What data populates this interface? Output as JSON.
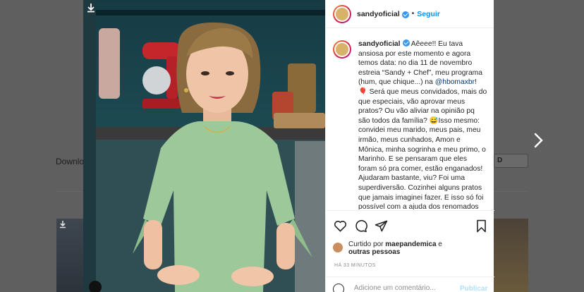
{
  "background": {
    "download_label": "Downlo",
    "pill_label": "D"
  },
  "post": {
    "header": {
      "username": "sandyoficial",
      "separator": "•",
      "follow_label": "Seguir"
    },
    "caption": {
      "username": "sandyoficial",
      "text_1": " Aêeee!! Eu tava ansiosa por este momento e agora temos data: no dia 11 de novembro estreia “Sandy + Chef”, meu programa (hum, que chique...) na ",
      "mention": "@hbomaxbr",
      "text_2": "! 🎈 Será que meus convidados, mais do que especiais, vão aprovar meus pratos? Ou vão aliviar na opinião pq são todos da família? 😅Isso mesmo: convidei meu marido, meus pais, meu irmão, meus cunhados, Amon e Mônica, minha sogrinha e meu primo, o Marinho. E se pensaram que eles foram só pra comer, estão enganados! Ajudaram bastante, viu? Foi uma superdiversão. Cozinhei alguns pratos que jamais imaginei fazer. E isso só foi possível com a ajuda dos renomados chefs Paola Carosella, Murakami, Lili"
    },
    "likes": {
      "prefix": "Curtido por ",
      "user": "maepandemica",
      "conjunction": " e",
      "others": "outras pessoas"
    },
    "timestamp": "HÁ 33 MINUTOS",
    "comment": {
      "placeholder": "Adicione um comentário...",
      "publish_label": "Publicar"
    }
  },
  "icons": {
    "like": "heart-icon",
    "comment": "comment-icon",
    "share": "paper-plane-icon",
    "save": "bookmark-icon",
    "next": "chevron-right-icon",
    "download": "download-icon",
    "emoji": "smiley-icon",
    "verified": "verified-badge-icon"
  },
  "colors": {
    "link_blue": "#0095f6",
    "verified_blue": "#3897f0",
    "muted_text": "#8e8e8e",
    "publish_disabled": "#b2dffc"
  }
}
